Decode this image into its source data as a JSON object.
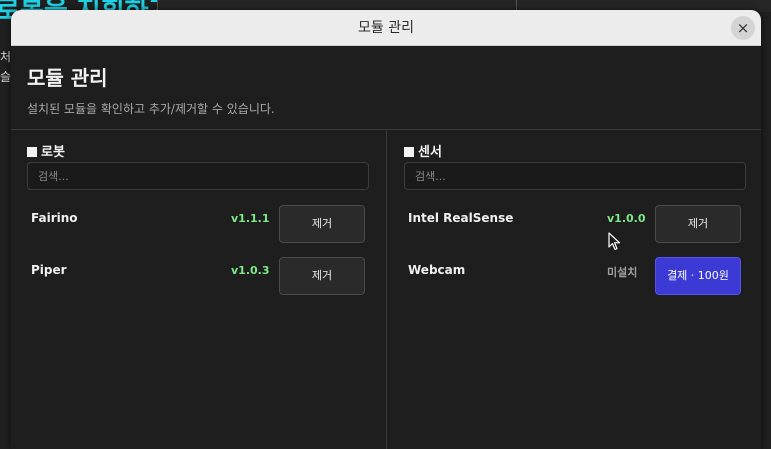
{
  "background": {
    "title": "로봇을 지휘하기",
    "line1": "처",
    "line2": "슬림"
  },
  "window": {
    "title": "모듈 관리",
    "close_icon": "×"
  },
  "header": {
    "title": "모듈 관리",
    "subtitle": "설치된 모듈을 확인하고 추가/제거할 수 있습니다."
  },
  "sections": [
    {
      "title": "로봇",
      "search_placeholder": "검색...",
      "items": [
        {
          "name": "Fairino",
          "version": "v1.1.1",
          "action": "제거"
        },
        {
          "name": "Piper",
          "version": "v1.0.3",
          "action": "제거"
        }
      ]
    },
    {
      "title": "센서",
      "search_placeholder": "검색...",
      "items": [
        {
          "name": "Intel RealSense",
          "version": "v1.0.0",
          "action": "제거"
        },
        {
          "name": "Webcam",
          "version": "미설치",
          "action": "결제 · 100원"
        }
      ]
    }
  ],
  "colors": {
    "accent": "#3b3ad4",
    "version_green": "#7ee787",
    "brand_cyan": "#1fd3e6"
  }
}
